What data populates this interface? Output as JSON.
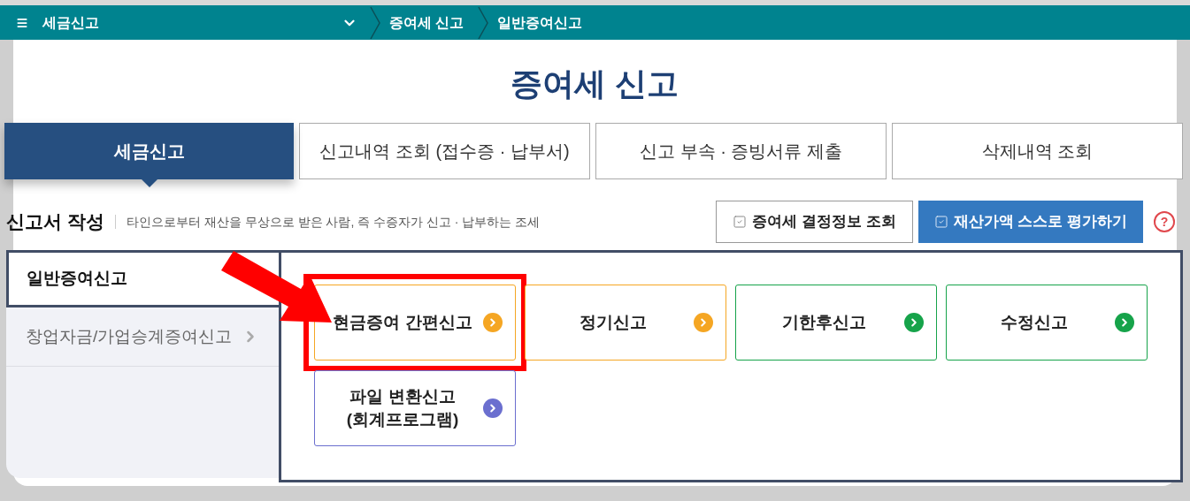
{
  "top_bar": {
    "menu_label": "세금신고",
    "breadcrumbs": [
      "증여세 신고",
      "일반증여신고"
    ]
  },
  "page_title": "증여세 신고",
  "tabs": [
    {
      "label": "세금신고",
      "selected": true
    },
    {
      "label": "신고내역 조회 (접수증 · 납부서)",
      "selected": false
    },
    {
      "label": "신고 부속 · 증빙서류 제출",
      "selected": false
    },
    {
      "label": "삭제내역 조회",
      "selected": false
    }
  ],
  "section": {
    "title": "신고서 작성",
    "description": "타인으로부터 재산을 무상으로 받은 사람, 즉 수증자가 신고 · 납부하는 조세"
  },
  "action_buttons": [
    {
      "label": "증여세 결정정보 조회",
      "kind": "outline"
    },
    {
      "label": "재산가액 스스로 평가하기",
      "kind": "primary"
    }
  ],
  "help": "?",
  "sidebar": [
    {
      "label": "일반증여신고",
      "selected": true
    },
    {
      "label": "창업자금/가업승계증여신고",
      "selected": false
    }
  ],
  "cards": [
    {
      "label": "현금증여 간편신고",
      "color": "#f5a623",
      "highlighted": true
    },
    {
      "label": "정기신고",
      "color": "#f5a623",
      "highlighted": false
    },
    {
      "label": "기한후신고",
      "color": "#16a34a",
      "highlighted": false
    },
    {
      "label": "수정신고",
      "color": "#16a34a",
      "highlighted": false
    },
    {
      "label": "파일 변환신고\n(회계프로그램)",
      "color": "#6b6fcf",
      "highlighted": false
    }
  ]
}
